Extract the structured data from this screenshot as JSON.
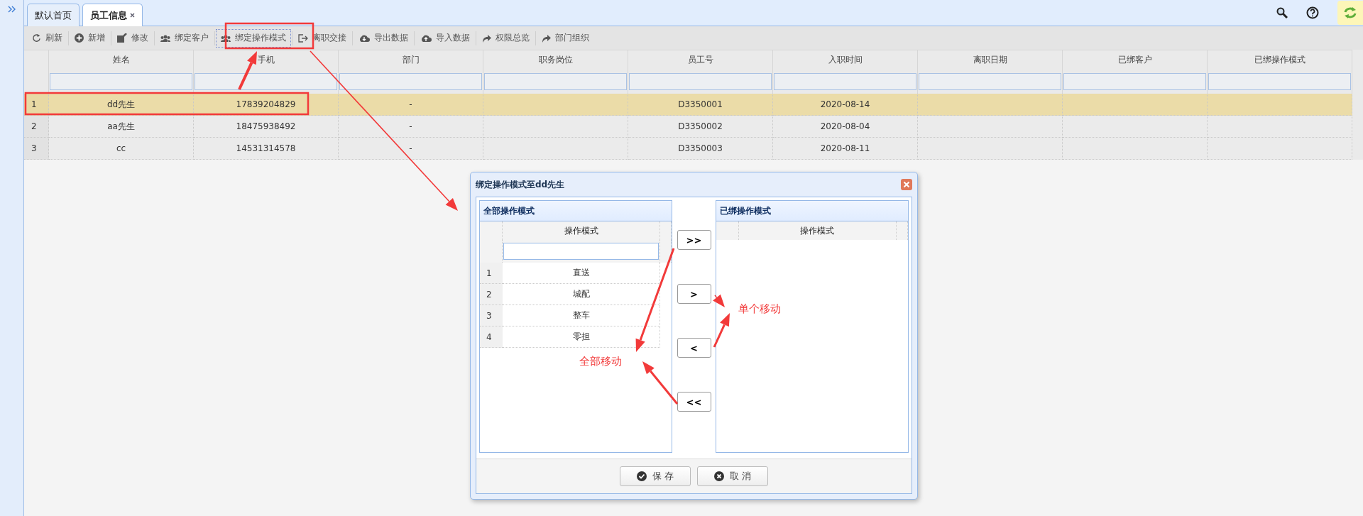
{
  "tabs": [
    {
      "label": "默认首页",
      "selected": false,
      "closable": false
    },
    {
      "label": "员工信息",
      "selected": true,
      "closable": true
    }
  ],
  "toolbar": [
    {
      "label": "刷新",
      "kind": "refresh",
      "focused": false
    },
    {
      "label": "新增",
      "kind": "add",
      "focused": false
    },
    {
      "label": "修改",
      "kind": "edit",
      "focused": false
    },
    {
      "label": "绑定客户",
      "kind": "users",
      "focused": false
    },
    {
      "label": "绑定操作模式",
      "kind": "users",
      "focused": true
    },
    {
      "label": "离职交接",
      "kind": "exit",
      "focused": false
    },
    {
      "label": "导出数据",
      "kind": "download",
      "focused": false
    },
    {
      "label": "导入数据",
      "kind": "upload",
      "focused": false
    },
    {
      "label": "权限总览",
      "kind": "share",
      "focused": false
    },
    {
      "label": "部门组织",
      "kind": "share",
      "focused": false
    }
  ],
  "table": {
    "columns": [
      "姓名",
      "手机",
      "部门",
      "职务岗位",
      "员工号",
      "入职时间",
      "离职日期",
      "已绑客户",
      "已绑操作模式"
    ],
    "rows": [
      {
        "index": "1",
        "selected": true,
        "name": "dd先生",
        "phone": "17839204829",
        "department": "-",
        "employee_no": "D3350001",
        "hire_date": "2020-08-14"
      },
      {
        "index": "2",
        "selected": false,
        "name": "aa先生",
        "phone": "18475938492",
        "department": "-",
        "employee_no": "D3350002",
        "hire_date": "2020-08-04"
      },
      {
        "index": "3",
        "selected": false,
        "name": "cc",
        "phone": "14531314578",
        "department": "-",
        "employee_no": "D3350003",
        "hire_date": "2020-08-11"
      }
    ]
  },
  "dialog": {
    "title": "绑定操作模式至dd先生",
    "left_panel": {
      "title": "全部操作模式",
      "column": "操作模式",
      "rows": [
        {
          "index": "1",
          "label": "直送"
        },
        {
          "index": "2",
          "label": "城配"
        },
        {
          "index": "3",
          "label": "整车"
        },
        {
          "index": "4",
          "label": "零担"
        }
      ]
    },
    "transfer_buttons": [
      ">>",
      ">",
      "<",
      "<<"
    ],
    "right_panel": {
      "title": "已绑操作模式",
      "column": "操作模式"
    },
    "buttons": [
      {
        "label": "保 存",
        "kind": "save"
      },
      {
        "label": "取 消",
        "kind": "cancel"
      }
    ]
  },
  "annotations": [
    {
      "text": "单个移动"
    },
    {
      "text": "全部移动"
    }
  ]
}
